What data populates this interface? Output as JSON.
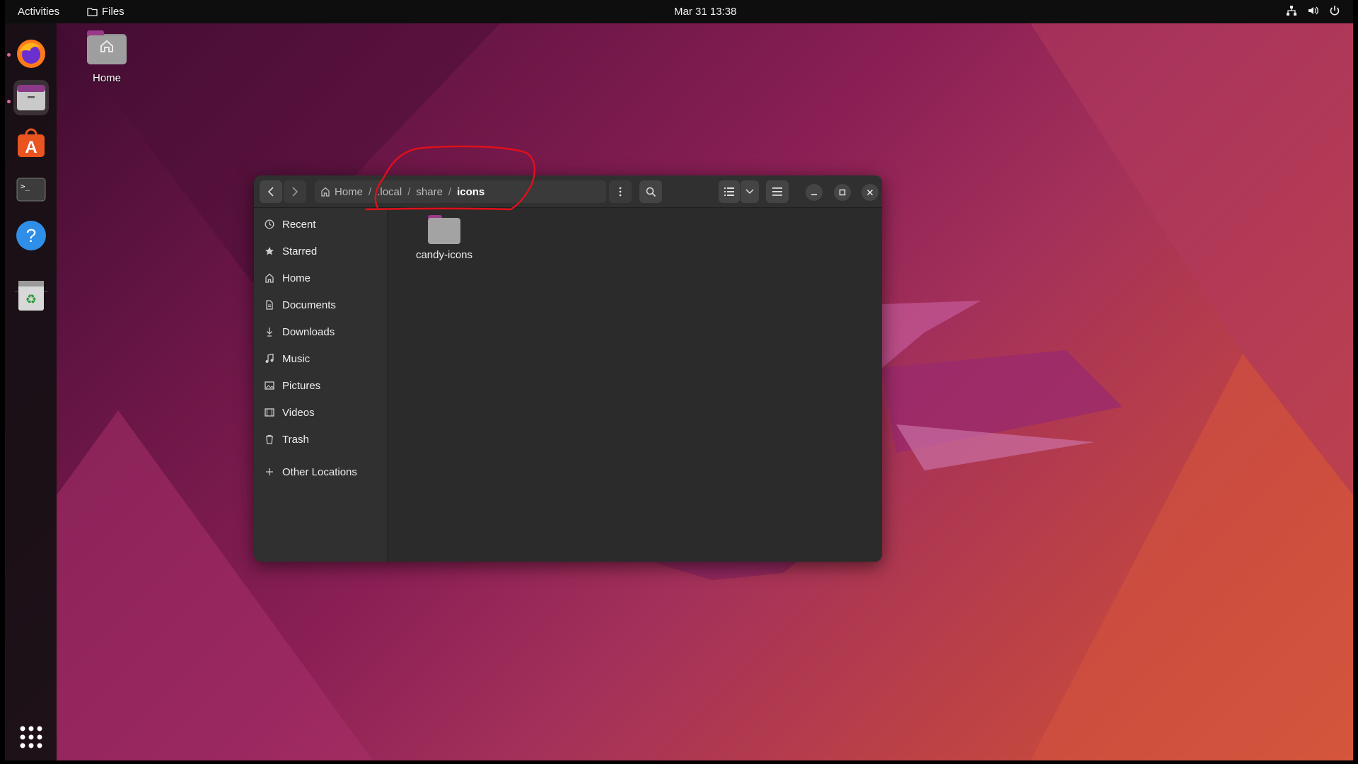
{
  "topbar": {
    "activities": "Activities",
    "app_name": "Files",
    "clock": "Mar 31  13:38"
  },
  "desktop": {
    "home_label": "Home"
  },
  "window": {
    "breadcrumbs": [
      {
        "label": "Home"
      },
      {
        "label": ".local"
      },
      {
        "label": "share"
      },
      {
        "label": "icons"
      }
    ],
    "sidebar": {
      "items": [
        {
          "label": "Recent",
          "icon": "clock-icon"
        },
        {
          "label": "Starred",
          "icon": "star-icon"
        },
        {
          "label": "Home",
          "icon": "home-icon"
        },
        {
          "label": "Documents",
          "icon": "document-icon"
        },
        {
          "label": "Downloads",
          "icon": "download-icon"
        },
        {
          "label": "Music",
          "icon": "music-icon"
        },
        {
          "label": "Pictures",
          "icon": "picture-icon"
        },
        {
          "label": "Videos",
          "icon": "video-icon"
        },
        {
          "label": "Trash",
          "icon": "trash-icon"
        }
      ],
      "other_locations": "Other Locations"
    },
    "files": [
      {
        "name": "candy-icons",
        "type": "folder"
      }
    ]
  },
  "dock": {
    "apps": [
      "firefox-icon",
      "files-icon",
      "app-center-icon",
      "terminal-icon",
      "help-icon",
      "trash-icon"
    ]
  },
  "colors": {
    "annotation": "#e0101a",
    "accent": "#e95420"
  }
}
